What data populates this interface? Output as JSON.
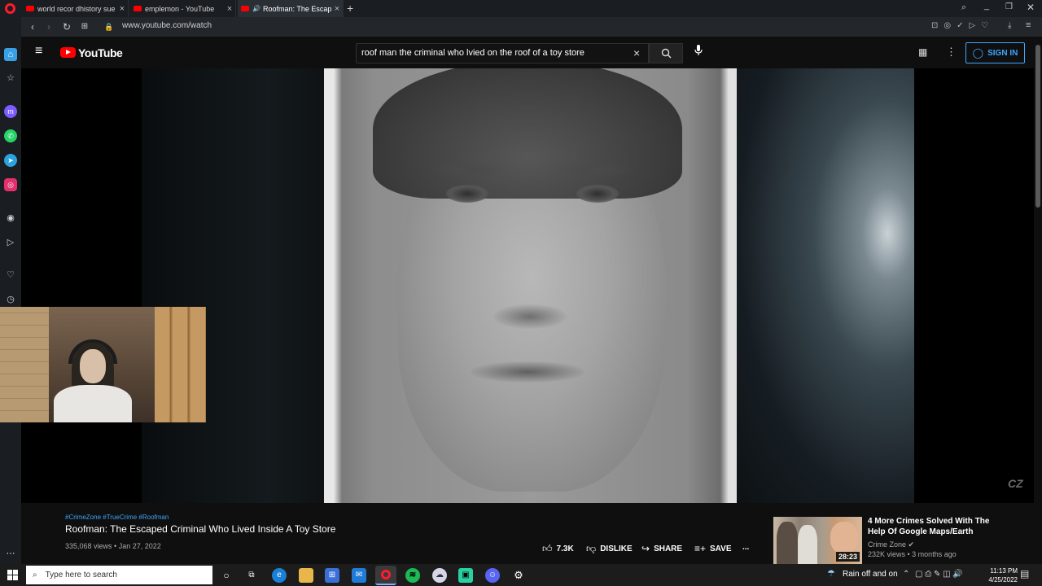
{
  "browser": {
    "tabs": [
      {
        "label": "world recor dhistory sue m"
      },
      {
        "label": "emplemon - YouTube"
      },
      {
        "label": "Roofman: The Escaped"
      }
    ],
    "url": "www.youtube.com/watch"
  },
  "youtube": {
    "logo_text": "YouTube",
    "search_query": "roof man the criminal who lvied on the roof of a toy store",
    "sign_in_label": "SIGN IN",
    "watermark": "CZ"
  },
  "video": {
    "hashtags": "#CrimeZone #TrueCrime #Roofman",
    "title": "Roofman: The Escaped Criminal Who Lived Inside A Toy Store",
    "meta": "335,068 views • Jan 27, 2022",
    "actions": {
      "like_count": "7.3K",
      "dislike_label": "DISLIKE",
      "share_label": "SHARE",
      "save_label": "SAVE",
      "more_label": "..."
    }
  },
  "recommendation": {
    "title": "4 More Crimes Solved With The Help Of Google Maps/Earth",
    "channel": "Crime Zone ✔",
    "stats": "232K views • 3 months ago",
    "duration": "28:23"
  },
  "taskbar": {
    "search_placeholder": "Type here to search",
    "weather": "Rain off and on",
    "time": "11:13 PM",
    "date": "4/25/2022"
  },
  "colors": {
    "accent_blue": "#3ea6ff",
    "youtube_red": "#ff0000",
    "opera_red": "#ff1b2d"
  }
}
